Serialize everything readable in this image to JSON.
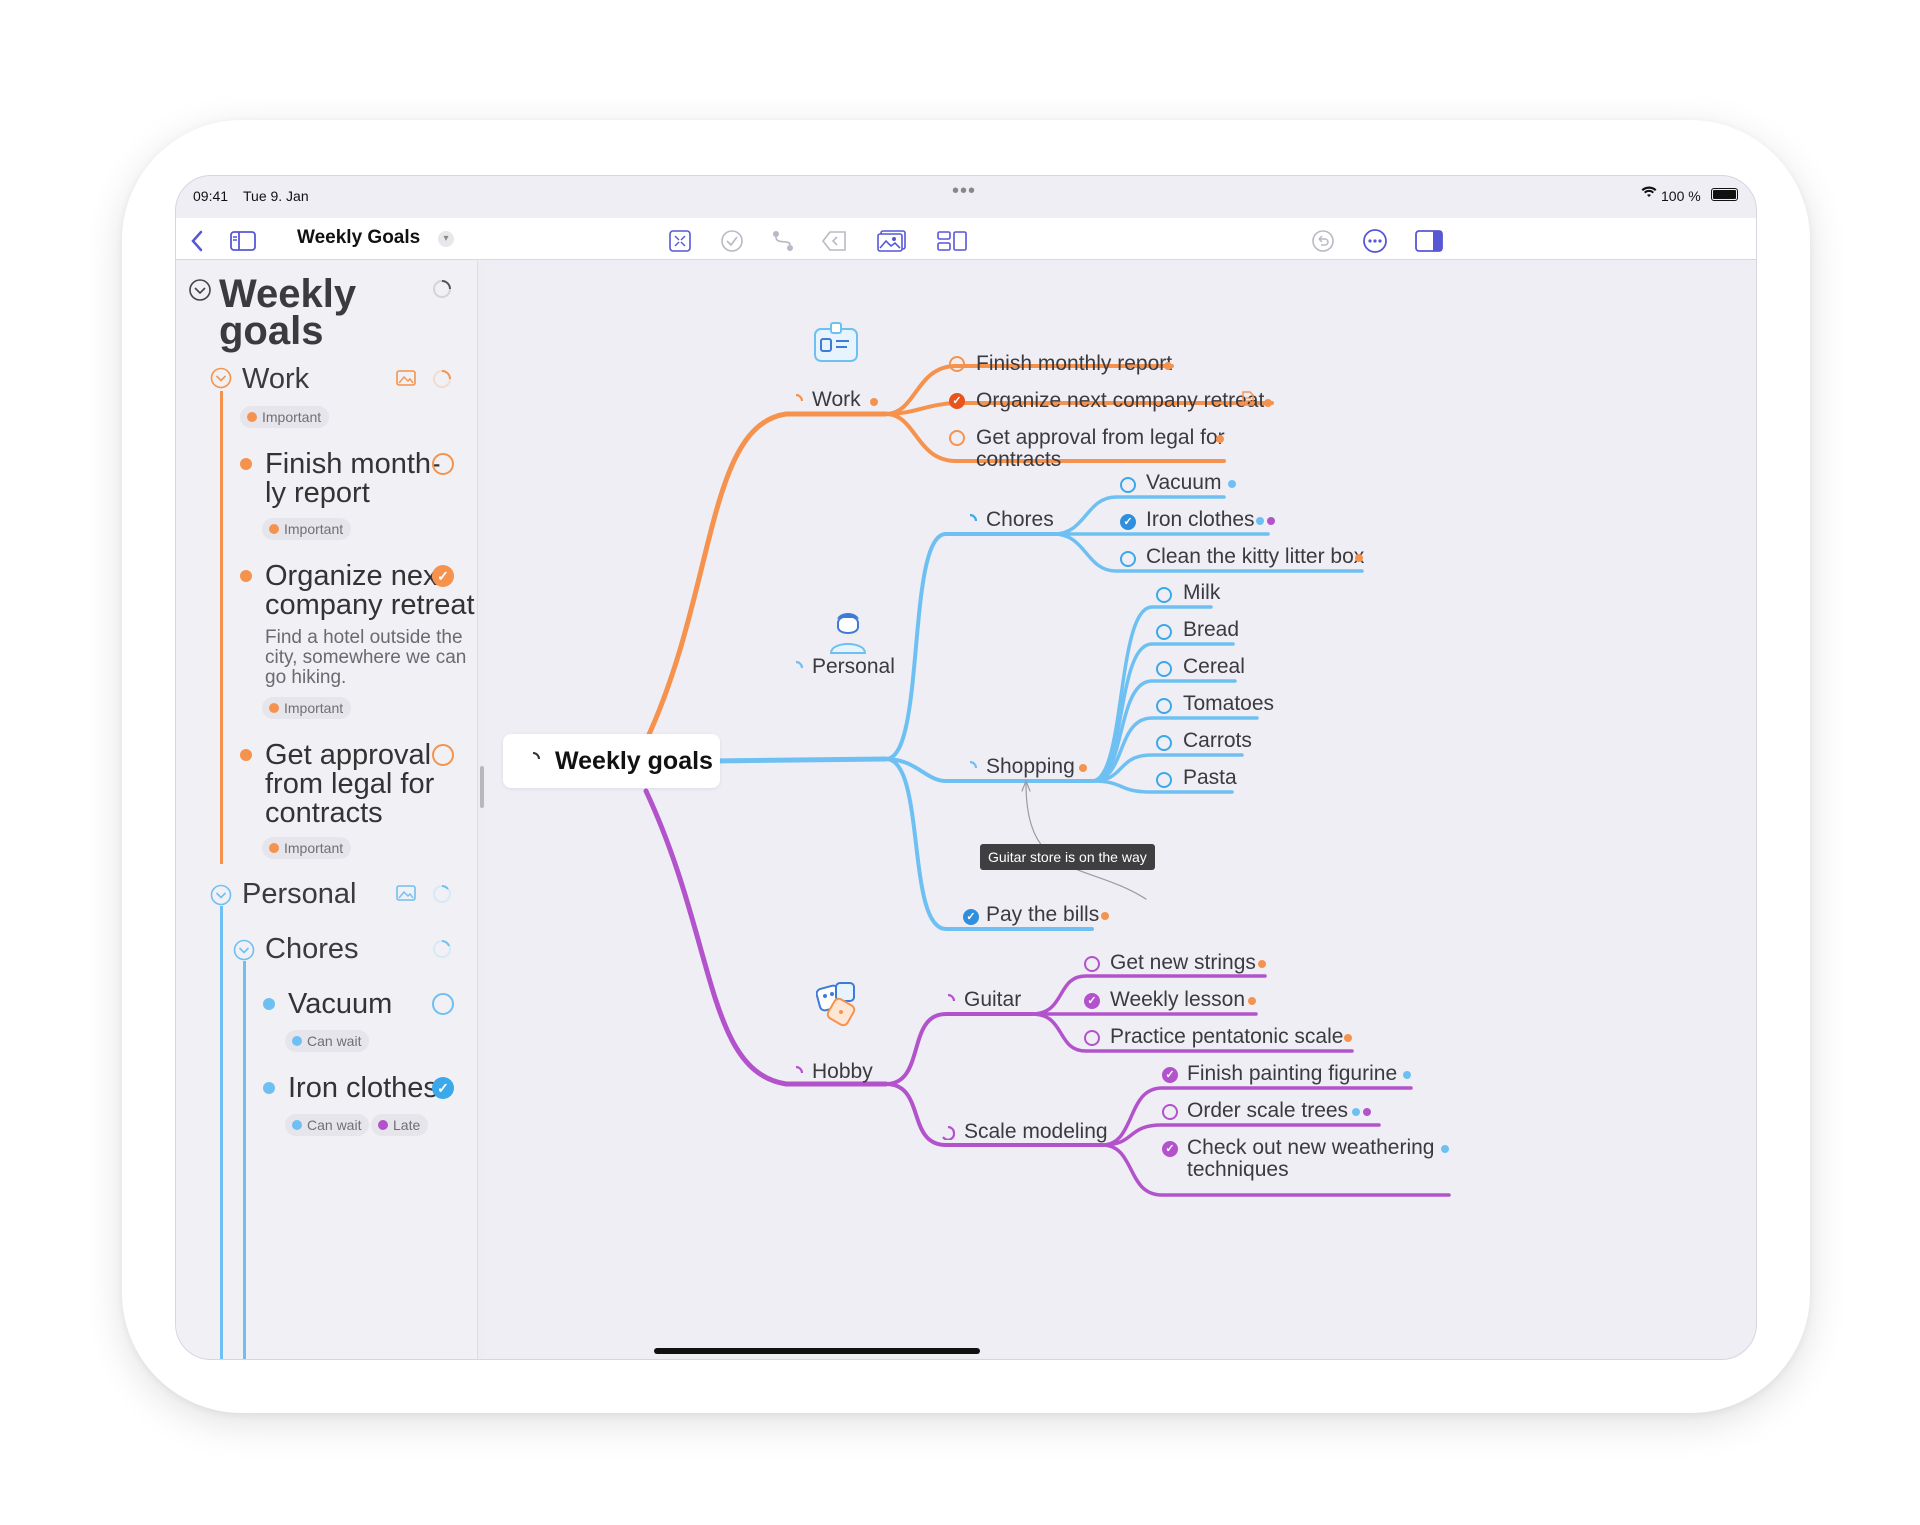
{
  "status": {
    "time": "09:41",
    "date": "Tue 9. Jan",
    "battery": "100 %"
  },
  "toolbar": {
    "title": "Weekly Goals"
  },
  "sidebar": {
    "title_line1": "Weekly",
    "title_line2": "goals",
    "work": {
      "label": "Work",
      "tag": "Important",
      "items": [
        {
          "line1": "Finish month-",
          "line2": "ly report",
          "tag": "Important"
        },
        {
          "line1": "Organize next",
          "line2": "company retreat",
          "note1": "Find a hotel outside the",
          "note2": "city, somewhere we can",
          "note3": "go hiking.",
          "tag": "Important"
        },
        {
          "line1": "Get approval",
          "line2": "from legal for",
          "line3": "contracts",
          "tag": "Important"
        }
      ]
    },
    "personal": {
      "label": "Personal",
      "chores": {
        "label": "Chores",
        "items": [
          {
            "label": "Vacuum",
            "tag": "Can wait"
          },
          {
            "label": "Iron clothes",
            "tag1": "Can wait",
            "tag2": "Late"
          }
        ]
      }
    }
  },
  "map": {
    "root": "Weekly goals",
    "work": {
      "label": "Work",
      "items": [
        "Finish monthly report",
        "Organize next company retreat",
        "Get approval from legal for",
        "contracts"
      ]
    },
    "personal": {
      "label": "Personal",
      "chores": {
        "label": "Chores",
        "items": [
          "Vacuum",
          "Iron clothes",
          "Clean the kitty litter box"
        ]
      },
      "shopping": {
        "label": "Shopping",
        "items": [
          "Milk",
          "Bread",
          "Cereal",
          "Tomatoes",
          "Carrots",
          "Pasta"
        ]
      },
      "bills": "Pay the bills"
    },
    "hobby": {
      "label": "Hobby",
      "guitar": {
        "label": "Guitar",
        "items": [
          "Get new strings",
          "Weekly lesson",
          "Practice pentatonic scale"
        ]
      },
      "scale": {
        "label": "Scale modeling",
        "items": [
          "Finish painting figurine",
          "Order scale trees",
          "Check out new weathering",
          "techniques"
        ]
      }
    },
    "tooltip": "Guitar store is on the way"
  },
  "colors": {
    "orange": "#f5934e",
    "blue": "#6ec0f2",
    "purple": "#b253cc",
    "accent": "#5757d6"
  }
}
